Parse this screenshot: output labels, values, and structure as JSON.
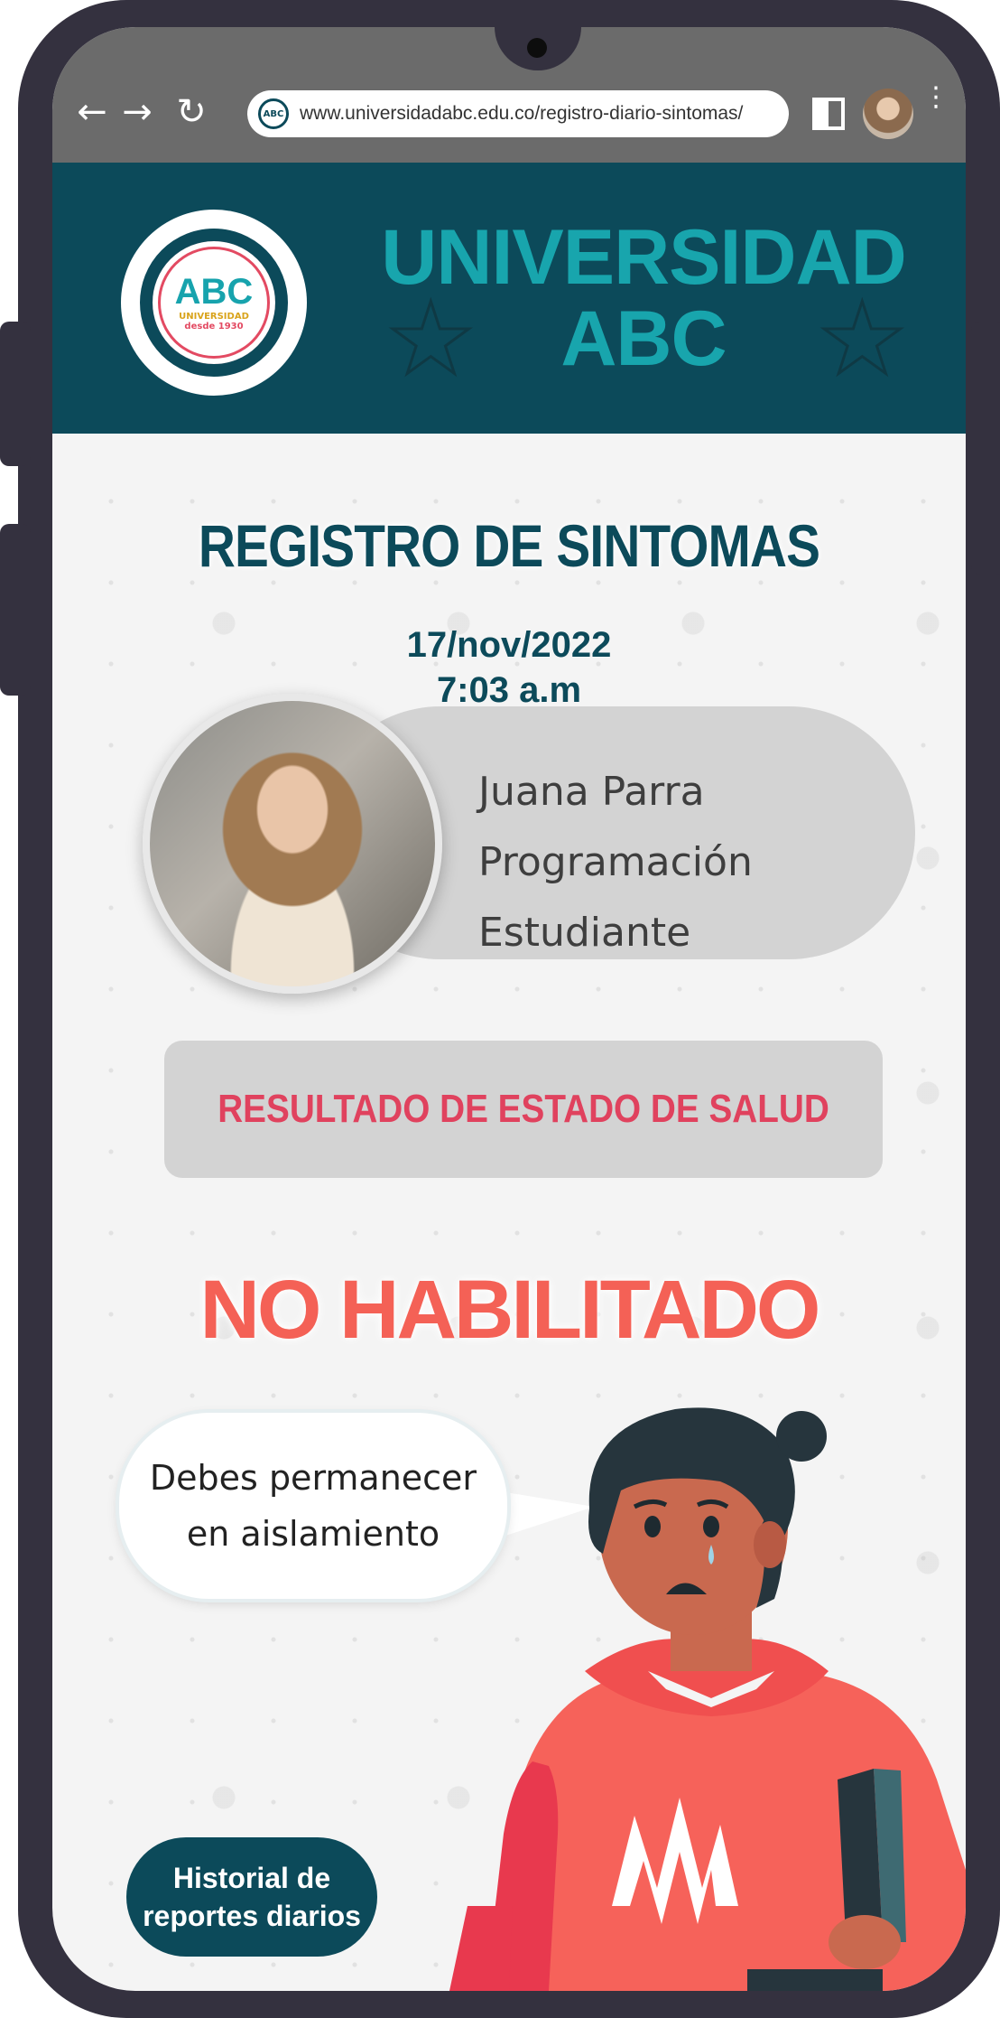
{
  "browser": {
    "url": "www.universidadabc.edu.co/registro-diario-sintomas/",
    "back_glyph": "←",
    "forward_glyph": "→",
    "reload_glyph": "↻",
    "menu_glyph": "⋮",
    "icons": [
      "back-arrow-icon",
      "forward-arrow-icon",
      "reload-icon",
      "site-logo-icon",
      "tab-switcher-icon",
      "profile-avatar",
      "more-options-icon"
    ]
  },
  "header": {
    "logo": {
      "abc": "ABC",
      "university": "UNIVERSIDAD",
      "since": "desde 1930"
    },
    "title_line1": "UNIVERSIDAD",
    "title_line2": "ABC"
  },
  "register": {
    "title": "REGISTRO DE SINTOMAS",
    "date": "17/nov/2022",
    "time": "7:03 a.m"
  },
  "profile": {
    "name": "Juana Parra",
    "program": "Programación",
    "role": "Estudiante"
  },
  "result": {
    "label": "RESULTADO DE ESTADO DE SALUD",
    "status": "NO HABILITADO"
  },
  "message": {
    "line1": "Debes permanecer",
    "line2": "en aislamiento"
  },
  "history_button": {
    "line1": "Historial de",
    "line2": "reportes diarios"
  },
  "colors": {
    "brand_dark": "#0c4a5a",
    "brand_teal": "#18a5ad",
    "alert_red": "#e0425e",
    "status_coral": "#f46156",
    "card_gray": "#d3d3d3",
    "frame": "#34313f"
  }
}
